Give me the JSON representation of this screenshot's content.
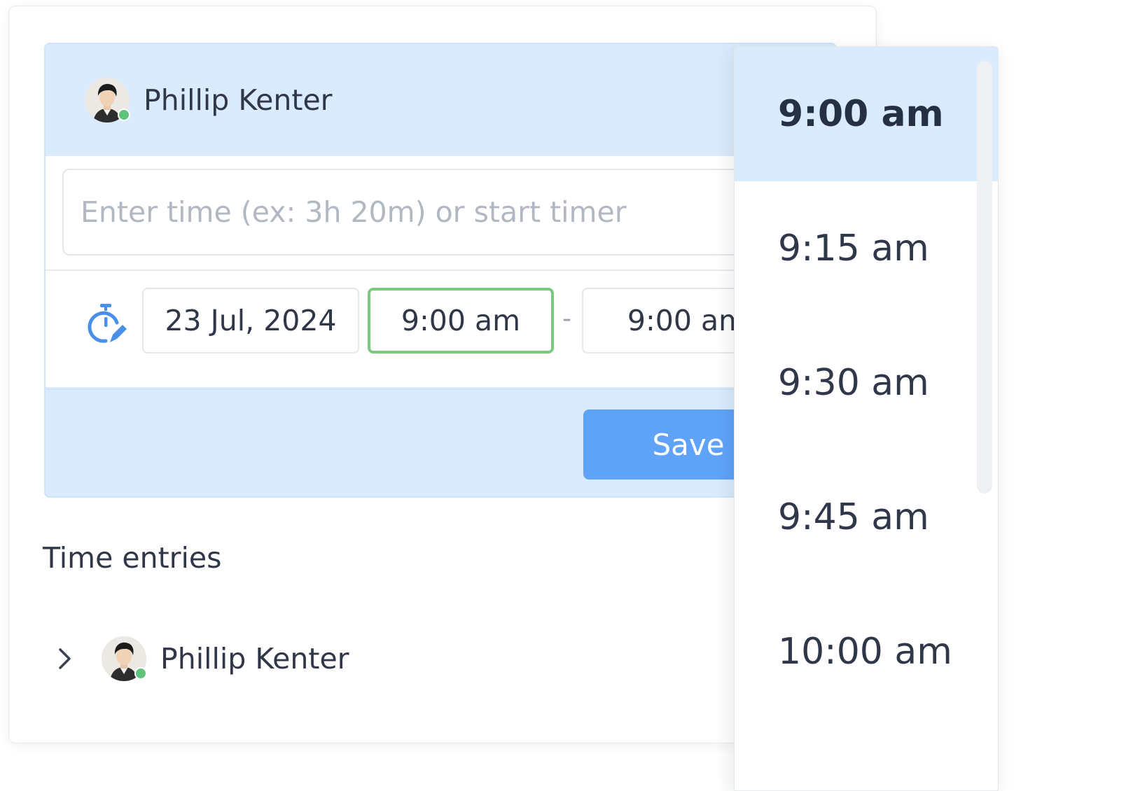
{
  "user": {
    "name": "Phillip Kenter"
  },
  "time_input": {
    "placeholder": "Enter time (ex: 3h 20m) or start timer"
  },
  "date_field": {
    "value": "23 Jul, 2024"
  },
  "start_time": {
    "value": "9:00 am"
  },
  "separator": "-",
  "end_time": {
    "value": "9:00 am"
  },
  "save_label": "Save",
  "entries": {
    "title": "Time entries",
    "items": [
      {
        "name": "Phillip Kenter"
      }
    ]
  },
  "dropdown": {
    "selected": "9:00 am",
    "options": [
      "9:00 am",
      "9:15 am",
      "9:30 am",
      "9:45 am",
      "10:00 am"
    ]
  },
  "colors": {
    "panel_bg": "#d9ebfc",
    "accent_blue": "#5ea3f8",
    "active_green": "#7bc97e",
    "online_dot": "#5fc47b"
  },
  "icons": [
    "stopwatch-edit-icon",
    "timer-ring-icon",
    "chevron-right-icon",
    "online-status-dot"
  ]
}
